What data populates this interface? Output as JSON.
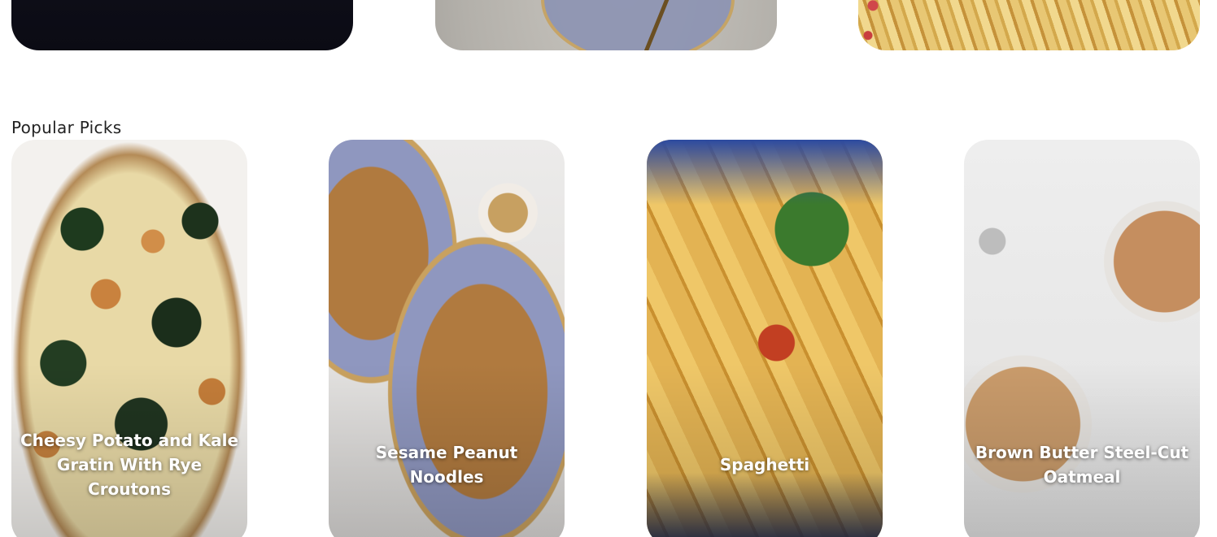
{
  "top_row": {
    "cards": [
      {
        "name": "top-card-1"
      },
      {
        "name": "top-card-2"
      },
      {
        "name": "top-card-3"
      }
    ]
  },
  "popular": {
    "heading": "Popular Picks",
    "cards": [
      {
        "title": "Cheesy Potato and Kale Gratin With Rye Croutons"
      },
      {
        "title": "Sesame Peanut Noodles"
      },
      {
        "title": "Spaghetti"
      },
      {
        "title": "Brown Butter Steel-Cut Oatmeal"
      }
    ]
  },
  "colors": {
    "card_title_text": "#ffffff",
    "heading_text": "#222222",
    "background": "#ffffff"
  }
}
